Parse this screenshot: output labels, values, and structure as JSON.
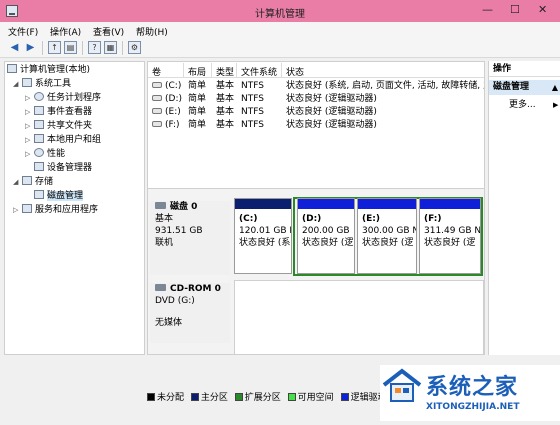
{
  "window": {
    "title": "计算机管理",
    "minimize": "—",
    "maximize": "☐",
    "close": "✕"
  },
  "menu": [
    "文件(F)",
    "操作(A)",
    "查看(V)",
    "帮助(H)"
  ],
  "tree": {
    "root": "计算机管理(本地)",
    "system_tools": "系统工具",
    "task_scheduler": "任务计划程序",
    "event_viewer": "事件查看器",
    "shared_folders": "共享文件夹",
    "local_users": "本地用户和组",
    "performance": "性能",
    "device_manager": "设备管理器",
    "storage": "存储",
    "disk_management": "磁盘管理",
    "services_apps": "服务和应用程序"
  },
  "volume_table": {
    "headers": [
      "卷",
      "布局",
      "类型",
      "文件系统",
      "状态"
    ],
    "rows": [
      [
        "(C:)",
        "简单",
        "基本",
        "NTFS",
        "状态良好 (系统, 启动, 页面文件, 活动, 故障转储, 主分"
      ],
      [
        "(D:)",
        "简单",
        "基本",
        "NTFS",
        "状态良好 (逻辑驱动器)"
      ],
      [
        "(E:)",
        "简单",
        "基本",
        "NTFS",
        "状态良好 (逻辑驱动器)"
      ],
      [
        "(F:)",
        "简单",
        "基本",
        "NTFS",
        "状态良好 (逻辑驱动器)"
      ]
    ]
  },
  "disk0": {
    "name": "磁盘 0",
    "type": "基本",
    "size": "931.51 GB",
    "status": "联机",
    "partitions": [
      {
        "letter": "(C:)",
        "size": "120.01 GB N",
        "status": "状态良好 (系",
        "bar_color": "#0a1f6e"
      },
      {
        "letter": "(D:)",
        "size": "200.00 GB",
        "status": "状态良好 (逻",
        "bar_color": "#1020d8"
      },
      {
        "letter": "(E:)",
        "size": "300.00 GB N",
        "status": "状态良好 (逻",
        "bar_color": "#1020d8"
      },
      {
        "letter": "(F:)",
        "size": "311.49 GB N",
        "status": "状态良好 (逻",
        "bar_color": "#1020d8"
      }
    ]
  },
  "cdrom0": {
    "name": "CD-ROM 0",
    "drive": "DVD (G:)",
    "media": "无媒体"
  },
  "actions": {
    "header": "操作",
    "selected": "磁盘管理",
    "more": "更多..."
  },
  "legend": [
    {
      "label": "未分配",
      "color": "#000000"
    },
    {
      "label": "主分区",
      "color": "#0a1f6e"
    },
    {
      "label": "扩展分区",
      "color": "#2a8a2a"
    },
    {
      "label": "可用空间",
      "color": "#48e048"
    },
    {
      "label": "逻辑驱动器",
      "color": "#1020d8"
    }
  ],
  "watermark": {
    "text": "系统之家",
    "url": "XITONGZHIJIA.NET"
  },
  "colors": {
    "titlebar": "#ea7da6",
    "selection": "#cde6f7",
    "extended_frame": "#2a8a2a"
  }
}
